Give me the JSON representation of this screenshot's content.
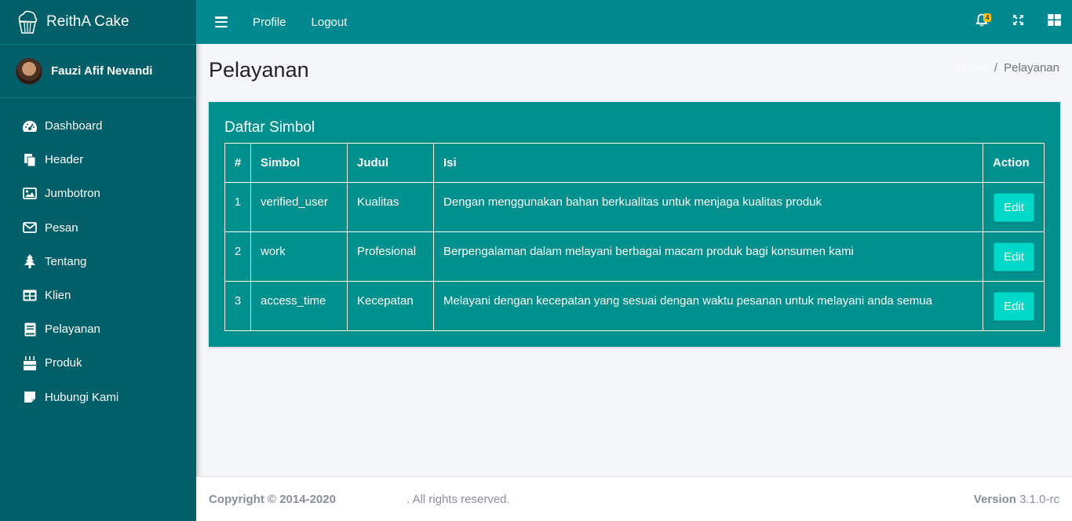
{
  "brand": {
    "name": "ReithA Cake"
  },
  "user": {
    "name": "Fauzi Afif Nevandi"
  },
  "sidebar": {
    "items": [
      {
        "label": "Dashboard",
        "icon": "tachometer-icon"
      },
      {
        "label": "Header",
        "icon": "copy-icon"
      },
      {
        "label": "Jumbotron",
        "icon": "image-icon"
      },
      {
        "label": "Pesan",
        "icon": "envelope-icon"
      },
      {
        "label": "Tentang",
        "icon": "tree-icon"
      },
      {
        "label": "Klien",
        "icon": "table-icon"
      },
      {
        "label": "Pelayanan",
        "icon": "book-icon"
      },
      {
        "label": "Produk",
        "icon": "birthday-cake-icon"
      },
      {
        "label": "Hubungi Kami",
        "icon": "sticky-note-icon"
      }
    ]
  },
  "topbar": {
    "links": {
      "profile": "Profile",
      "logout": "Logout"
    },
    "notification_count": "4"
  },
  "page": {
    "title": "Pelayanan",
    "breadcrumb": {
      "home": "Home",
      "separator": "/",
      "current": "Pelayanan"
    }
  },
  "card": {
    "title": "Daftar Simbol",
    "columns": {
      "num": "#",
      "simbol": "Simbol",
      "judul": "Judul",
      "isi": "Isi",
      "action": "Action"
    },
    "rows": [
      {
        "num": "1",
        "simbol": "verified_user",
        "judul": "Kualitas",
        "isi": "Dengan menggunakan bahan berkualitas untuk menjaga kualitas produk",
        "action": "Edit"
      },
      {
        "num": "2",
        "simbol": "work",
        "judul": "Profesional",
        "isi": "Berpengalaman dalam melayani berbagai macam produk bagi konsumen kami",
        "action": "Edit"
      },
      {
        "num": "3",
        "simbol": "access_time",
        "judul": "Kecepatan",
        "isi": "Melayani dengan kecepatan yang sesuai dengan waktu pesanan untuk melayani anda semua",
        "action": "Edit"
      }
    ]
  },
  "footer": {
    "copyright": "Copyright © 2014-2020",
    "rights": ". All rights reserved.",
    "version_label": "Version",
    "version": "3.1.0-rc"
  },
  "colors": {
    "sidebar": "#005f69",
    "topbar": "#008a8f",
    "card": "#00918f",
    "edit_button": "#00d9c8",
    "badge": "#ffc107"
  }
}
